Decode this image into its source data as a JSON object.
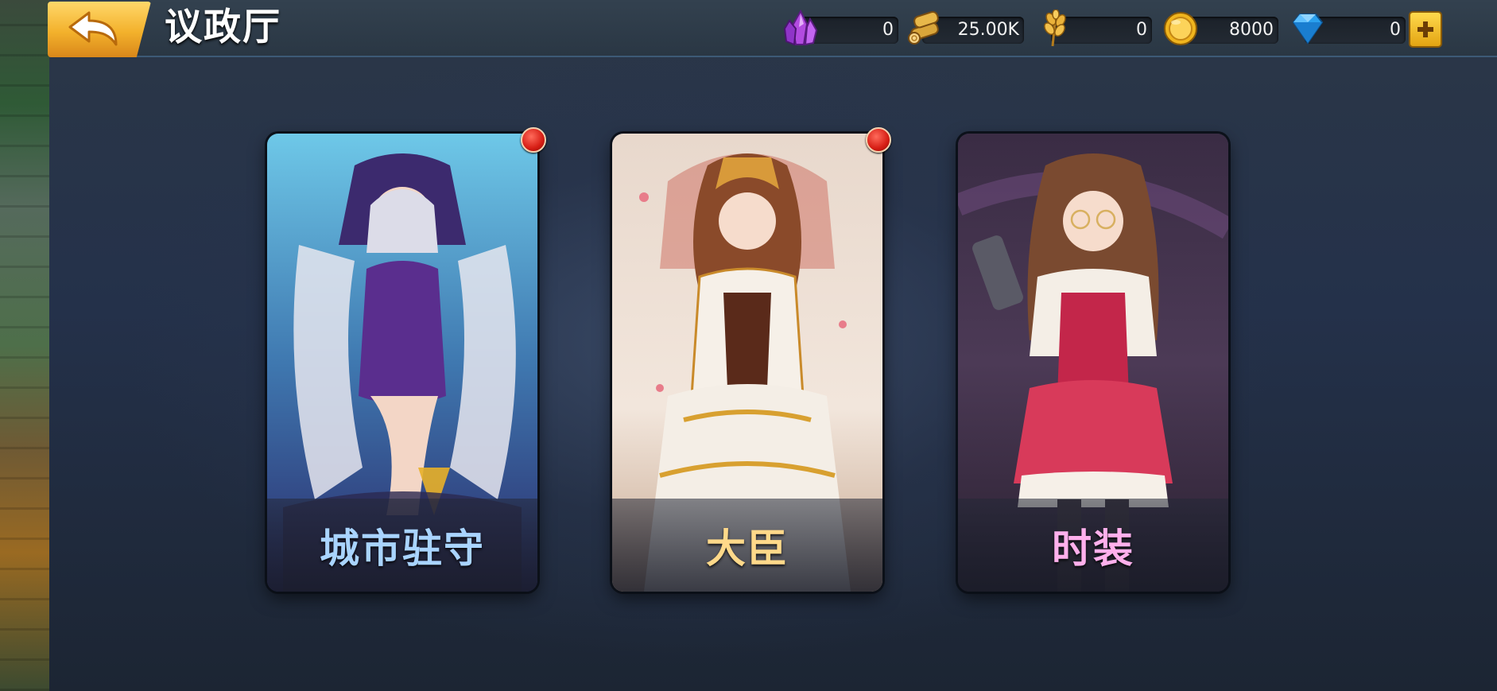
{
  "header": {
    "title": "议政厅",
    "back_icon": "back-arrow-icon"
  },
  "resources": [
    {
      "name": "crystal",
      "icon": "purple-crystal-icon",
      "value": "0"
    },
    {
      "name": "wood",
      "icon": "wood-logs-icon",
      "value": "25.00K"
    },
    {
      "name": "grain",
      "icon": "wheat-icon",
      "value": "0"
    },
    {
      "name": "gold",
      "icon": "gold-coin-icon",
      "value": "8000"
    },
    {
      "name": "diamond",
      "icon": "blue-diamond-icon",
      "value": "0"
    }
  ],
  "plus_icon": "plus-icon",
  "cards": [
    {
      "label": "城市驻守",
      "label_color": "#a9d4ff",
      "has_notification": true
    },
    {
      "label": "大臣",
      "label_color": "#ffd98a",
      "has_notification": true
    },
    {
      "label": "时装",
      "label_color": "#ffb0ec",
      "has_notification": false
    }
  ],
  "colors": {
    "accent_gold": "#f3b12c",
    "notification_red": "#d61d14"
  }
}
